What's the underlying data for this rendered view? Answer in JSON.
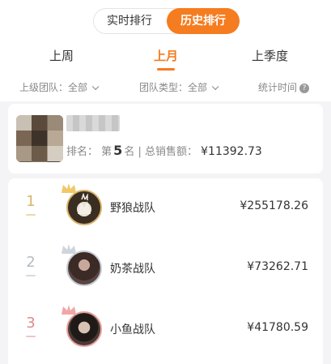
{
  "tabs": {
    "realtime": "实时排行",
    "history": "历史排行"
  },
  "periods": [
    "上周",
    "上月",
    "上季度"
  ],
  "filters": {
    "parent_team": "上级团队：全部",
    "team_type": "团队类型：全部",
    "stat_time": "统计时间"
  },
  "my": {
    "rank_label": "排名：",
    "rank_prefix": "第",
    "rank_value": "5",
    "rank_suffix": "名",
    "total_label": "| 总销售额：",
    "total_value": "¥11392.73"
  },
  "teams": [
    {
      "rank": "1",
      "name": "野狼战队",
      "sales": "¥255178.26"
    },
    {
      "rank": "2",
      "name": "奶茶战队",
      "sales": "¥73262.71"
    },
    {
      "rank": "3",
      "name": "小鱼战队",
      "sales": "¥41780.59"
    }
  ],
  "colors": {
    "accent": "#f57c1f",
    "rank1": "#d9b46a",
    "rank2": "#b5bcc6",
    "rank3": "#e08a8a"
  }
}
